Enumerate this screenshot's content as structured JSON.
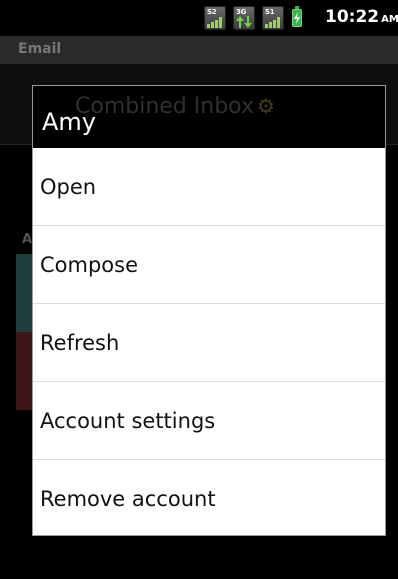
{
  "status_bar": {
    "time": "10:22",
    "ampm": "AM",
    "icons": [
      {
        "name": "signal-s2-icon",
        "tag": "S2"
      },
      {
        "name": "data-3g-icon",
        "tag": "3G"
      },
      {
        "name": "signal-s1-icon",
        "tag": "S1"
      },
      {
        "name": "battery-charging-icon"
      }
    ]
  },
  "background_app": {
    "title": "Email",
    "combined_inbox": "Combined Inbox"
  },
  "context_menu": {
    "title": "Amy",
    "items": [
      {
        "label": "Open"
      },
      {
        "label": "Compose"
      },
      {
        "label": "Refresh"
      },
      {
        "label": "Account settings"
      },
      {
        "label": "Remove account"
      }
    ]
  },
  "colors": {
    "status_bar_bg": "#000000",
    "dialog_header_bg": "#000000",
    "dialog_body_bg": "#ffffff",
    "battery": "#39b54a",
    "account_strip_teal": "#1f3d3b",
    "account_strip_red": "#3f1518"
  }
}
